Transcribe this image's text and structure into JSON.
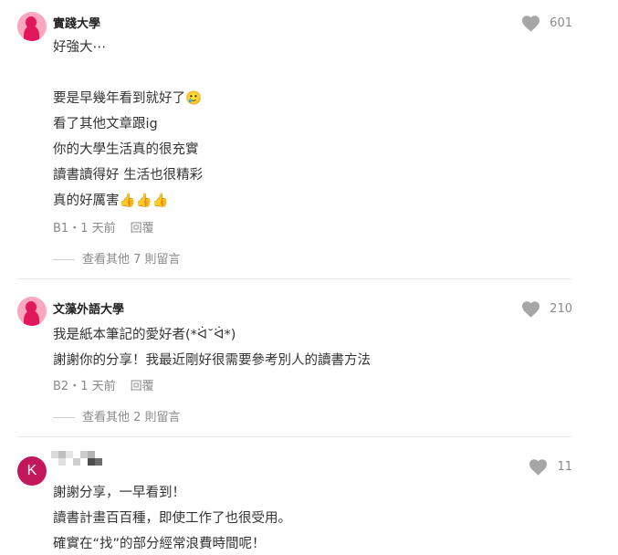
{
  "comments": [
    {
      "author": "實踐大學",
      "likes": "601",
      "lines": [
        "好強大⋯",
        "",
        "要是早幾年看到就好了🥲",
        "看了其他文章跟ig",
        "你的大學生活真的很充實",
        "讀書讀得好 生活也很精彩",
        "真的好厲害👍👍👍"
      ],
      "floor_time": "B1・1 天前",
      "reply_label": "回覆",
      "view_replies": "查看其他 7 則留言"
    },
    {
      "author": "文藻外語大學",
      "likes": "210",
      "lines": [
        "我是紙本筆記的愛好者(*ᐛ˘ᐛ*)",
        "謝謝你的分享！我最近剛好很需要參考別人的讀書方法"
      ],
      "floor_time": "B2・1 天前",
      "reply_label": "回覆",
      "view_replies": "查看其他 2 則留言"
    },
    {
      "author_initial": "K",
      "likes": "11",
      "lines": [
        "謝謝分享，一早看到！",
        "讀書計畫百百種，即使工作了也很受用。",
        "確實在“找”的部分經常浪費時間呢！"
      ]
    }
  ],
  "colors": {
    "avatar_pink_bg": "#f9a7bf",
    "avatar_pink_fg": "#e1185c",
    "avatar_k_bg": "#c2185b",
    "heart": "#a6a6a6",
    "meta_text": "#8a8a8a"
  },
  "icons": [
    "heart-icon",
    "school-avatar-icon"
  ]
}
